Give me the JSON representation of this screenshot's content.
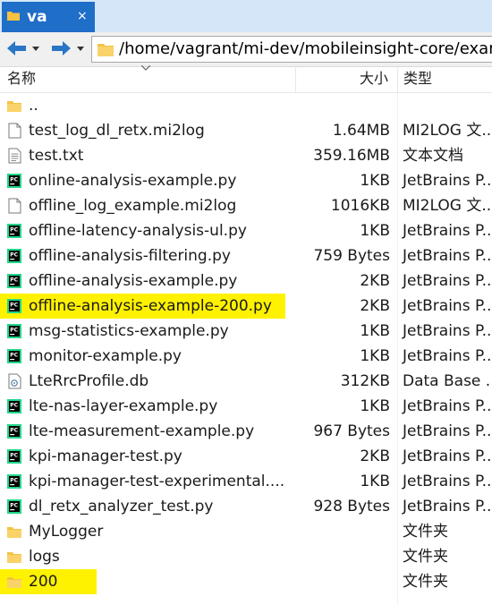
{
  "tab": {
    "title": "va",
    "close": "×"
  },
  "address": {
    "path": "/home/vagrant/mi-dev/mobileinsight-core/exam"
  },
  "columns": {
    "name": "名称",
    "size": "大小",
    "type": "类型"
  },
  "files": [
    {
      "name": "..",
      "size": "",
      "type": "",
      "icon": "folder-icon"
    },
    {
      "name": "test_log_dl_retx.mi2log",
      "size": "1.64MB",
      "type": "MI2LOG 文...",
      "icon": "file-icon"
    },
    {
      "name": "test.txt",
      "size": "359.16MB",
      "type": "文本文档",
      "icon": "text-file-icon"
    },
    {
      "name": "online-analysis-example.py",
      "size": "1KB",
      "type": "JetBrains P...",
      "icon": "pycharm-icon"
    },
    {
      "name": "offline_log_example.mi2log",
      "size": "1016KB",
      "type": "MI2LOG 文...",
      "icon": "file-icon"
    },
    {
      "name": "offline-latency-analysis-ul.py",
      "size": "1KB",
      "type": "JetBrains P...",
      "icon": "pycharm-icon"
    },
    {
      "name": "offline-analysis-filtering.py",
      "size": "759 Bytes",
      "type": "JetBrains P...",
      "icon": "pycharm-icon"
    },
    {
      "name": "offline-analysis-example.py",
      "size": "2KB",
      "type": "JetBrains P...",
      "icon": "pycharm-icon"
    },
    {
      "name": "offline-analysis-example-200.py",
      "size": "2KB",
      "type": "JetBrains P...",
      "icon": "pycharm-icon",
      "highlight": true
    },
    {
      "name": "msg-statistics-example.py",
      "size": "1KB",
      "type": "JetBrains P...",
      "icon": "pycharm-icon"
    },
    {
      "name": "monitor-example.py",
      "size": "1KB",
      "type": "JetBrains P...",
      "icon": "pycharm-icon"
    },
    {
      "name": "LteRrcProfile.db",
      "size": "312KB",
      "type": "Data Base ...",
      "icon": "database-file-icon"
    },
    {
      "name": "lte-nas-layer-example.py",
      "size": "1KB",
      "type": "JetBrains P...",
      "icon": "pycharm-icon"
    },
    {
      "name": "lte-measurement-example.py",
      "size": "967 Bytes",
      "type": "JetBrains P...",
      "icon": "pycharm-icon"
    },
    {
      "name": "kpi-manager-test.py",
      "size": "2KB",
      "type": "JetBrains P...",
      "icon": "pycharm-icon"
    },
    {
      "name": "kpi-manager-test-experimental....",
      "size": "1KB",
      "type": "JetBrains P...",
      "icon": "pycharm-icon"
    },
    {
      "name": "dl_retx_analyzer_test.py",
      "size": "928 Bytes",
      "type": "JetBrains P...",
      "icon": "pycharm-icon"
    },
    {
      "name": "MyLogger",
      "size": "",
      "type": "文件夹",
      "icon": "folder-icon"
    },
    {
      "name": "logs",
      "size": "",
      "type": "文件夹",
      "icon": "folder-icon"
    },
    {
      "name": "200",
      "size": "",
      "type": "文件夹",
      "icon": "folder-icon",
      "highlight": true
    }
  ],
  "colors": {
    "tab": "#1f6ec8",
    "tabbar": "#d4e6f7",
    "highlight": "#fff200",
    "folder": "#f5c242"
  }
}
